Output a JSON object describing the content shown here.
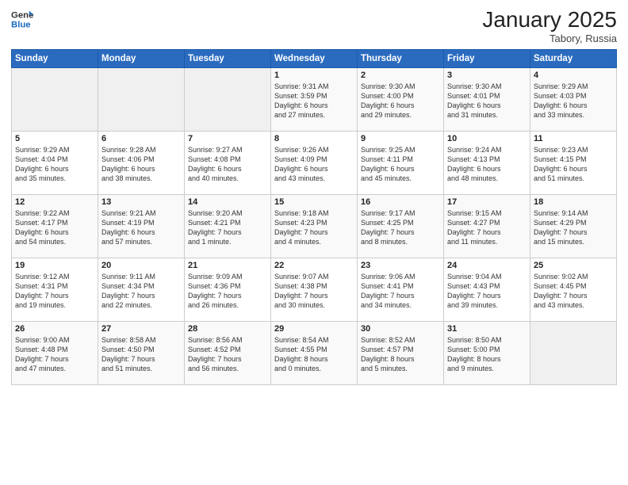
{
  "header": {
    "logo_general": "General",
    "logo_blue": "Blue",
    "month_title": "January 2025",
    "location": "Tabory, Russia"
  },
  "days_of_week": [
    "Sunday",
    "Monday",
    "Tuesday",
    "Wednesday",
    "Thursday",
    "Friday",
    "Saturday"
  ],
  "weeks": [
    [
      {
        "num": "",
        "info": ""
      },
      {
        "num": "",
        "info": ""
      },
      {
        "num": "",
        "info": ""
      },
      {
        "num": "1",
        "info": "Sunrise: 9:31 AM\nSunset: 3:59 PM\nDaylight: 6 hours\nand 27 minutes."
      },
      {
        "num": "2",
        "info": "Sunrise: 9:30 AM\nSunset: 4:00 PM\nDaylight: 6 hours\nand 29 minutes."
      },
      {
        "num": "3",
        "info": "Sunrise: 9:30 AM\nSunset: 4:01 PM\nDaylight: 6 hours\nand 31 minutes."
      },
      {
        "num": "4",
        "info": "Sunrise: 9:29 AM\nSunset: 4:03 PM\nDaylight: 6 hours\nand 33 minutes."
      }
    ],
    [
      {
        "num": "5",
        "info": "Sunrise: 9:29 AM\nSunset: 4:04 PM\nDaylight: 6 hours\nand 35 minutes."
      },
      {
        "num": "6",
        "info": "Sunrise: 9:28 AM\nSunset: 4:06 PM\nDaylight: 6 hours\nand 38 minutes."
      },
      {
        "num": "7",
        "info": "Sunrise: 9:27 AM\nSunset: 4:08 PM\nDaylight: 6 hours\nand 40 minutes."
      },
      {
        "num": "8",
        "info": "Sunrise: 9:26 AM\nSunset: 4:09 PM\nDaylight: 6 hours\nand 43 minutes."
      },
      {
        "num": "9",
        "info": "Sunrise: 9:25 AM\nSunset: 4:11 PM\nDaylight: 6 hours\nand 45 minutes."
      },
      {
        "num": "10",
        "info": "Sunrise: 9:24 AM\nSunset: 4:13 PM\nDaylight: 6 hours\nand 48 minutes."
      },
      {
        "num": "11",
        "info": "Sunrise: 9:23 AM\nSunset: 4:15 PM\nDaylight: 6 hours\nand 51 minutes."
      }
    ],
    [
      {
        "num": "12",
        "info": "Sunrise: 9:22 AM\nSunset: 4:17 PM\nDaylight: 6 hours\nand 54 minutes."
      },
      {
        "num": "13",
        "info": "Sunrise: 9:21 AM\nSunset: 4:19 PM\nDaylight: 6 hours\nand 57 minutes."
      },
      {
        "num": "14",
        "info": "Sunrise: 9:20 AM\nSunset: 4:21 PM\nDaylight: 7 hours\nand 1 minute."
      },
      {
        "num": "15",
        "info": "Sunrise: 9:18 AM\nSunset: 4:23 PM\nDaylight: 7 hours\nand 4 minutes."
      },
      {
        "num": "16",
        "info": "Sunrise: 9:17 AM\nSunset: 4:25 PM\nDaylight: 7 hours\nand 8 minutes."
      },
      {
        "num": "17",
        "info": "Sunrise: 9:15 AM\nSunset: 4:27 PM\nDaylight: 7 hours\nand 11 minutes."
      },
      {
        "num": "18",
        "info": "Sunrise: 9:14 AM\nSunset: 4:29 PM\nDaylight: 7 hours\nand 15 minutes."
      }
    ],
    [
      {
        "num": "19",
        "info": "Sunrise: 9:12 AM\nSunset: 4:31 PM\nDaylight: 7 hours\nand 19 minutes."
      },
      {
        "num": "20",
        "info": "Sunrise: 9:11 AM\nSunset: 4:34 PM\nDaylight: 7 hours\nand 22 minutes."
      },
      {
        "num": "21",
        "info": "Sunrise: 9:09 AM\nSunset: 4:36 PM\nDaylight: 7 hours\nand 26 minutes."
      },
      {
        "num": "22",
        "info": "Sunrise: 9:07 AM\nSunset: 4:38 PM\nDaylight: 7 hours\nand 30 minutes."
      },
      {
        "num": "23",
        "info": "Sunrise: 9:06 AM\nSunset: 4:41 PM\nDaylight: 7 hours\nand 34 minutes."
      },
      {
        "num": "24",
        "info": "Sunrise: 9:04 AM\nSunset: 4:43 PM\nDaylight: 7 hours\nand 39 minutes."
      },
      {
        "num": "25",
        "info": "Sunrise: 9:02 AM\nSunset: 4:45 PM\nDaylight: 7 hours\nand 43 minutes."
      }
    ],
    [
      {
        "num": "26",
        "info": "Sunrise: 9:00 AM\nSunset: 4:48 PM\nDaylight: 7 hours\nand 47 minutes."
      },
      {
        "num": "27",
        "info": "Sunrise: 8:58 AM\nSunset: 4:50 PM\nDaylight: 7 hours\nand 51 minutes."
      },
      {
        "num": "28",
        "info": "Sunrise: 8:56 AM\nSunset: 4:52 PM\nDaylight: 7 hours\nand 56 minutes."
      },
      {
        "num": "29",
        "info": "Sunrise: 8:54 AM\nSunset: 4:55 PM\nDaylight: 8 hours\nand 0 minutes."
      },
      {
        "num": "30",
        "info": "Sunrise: 8:52 AM\nSunset: 4:57 PM\nDaylight: 8 hours\nand 5 minutes."
      },
      {
        "num": "31",
        "info": "Sunrise: 8:50 AM\nSunset: 5:00 PM\nDaylight: 8 hours\nand 9 minutes."
      },
      {
        "num": "",
        "info": ""
      }
    ]
  ]
}
